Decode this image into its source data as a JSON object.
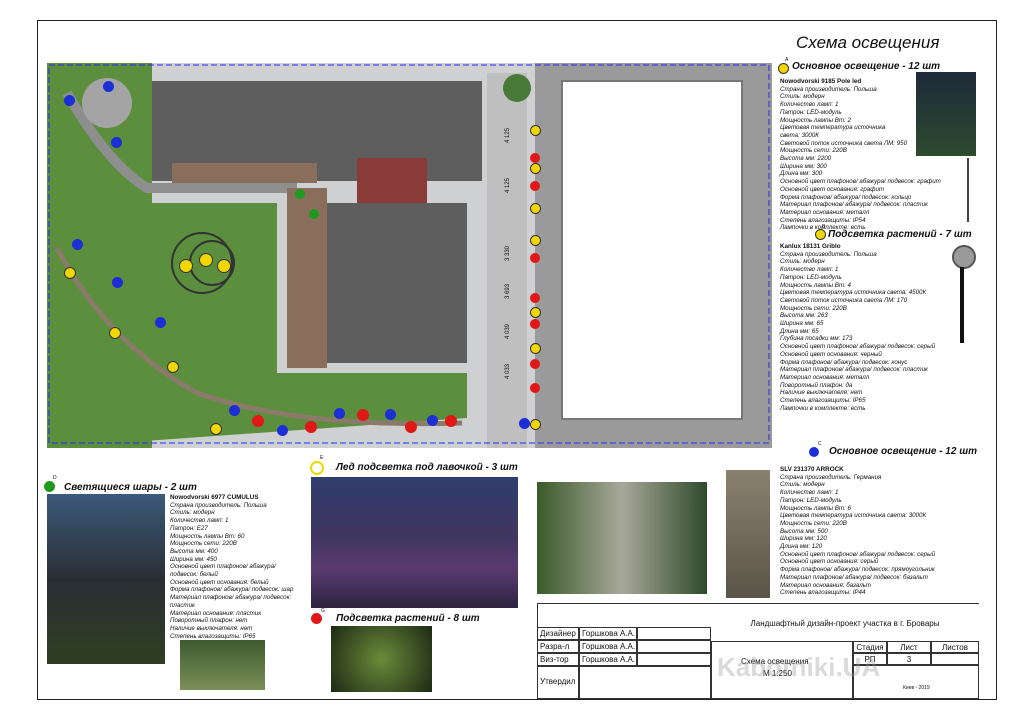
{
  "title": "Схема освещения",
  "sections": {
    "main_top": "Основное освещение - 12 шт",
    "plants_top": "Подсветка растений - 7 шт",
    "main_bottom": "Основное освещение - 12 шт",
    "spheres": "Светящиеся шары - 2 шт",
    "bench": "Лед подсветка под лавочкой - 3 шт",
    "plants_bottom": "Подсветка растений - 8 шт"
  },
  "markers": {
    "a": "A",
    "b": "B",
    "c": "C",
    "d": "D",
    "e": "E",
    "f": "F",
    "g": "G"
  },
  "colors": {
    "yellow": "#f2d600",
    "blue": "#1c2fd6",
    "green": "#1f9a1f",
    "red": "#e01818",
    "lawn": "#5b8f3e",
    "roof": "#5e5e5e"
  },
  "spec_pole": [
    "Nowodvorski 9185 Pole led",
    "Страна производитель: Польша",
    "Стиль: модерн",
    "Количество ламп: 1",
    "Патрон: LED-модуль",
    "Мощность лампы Вт: 2",
    "Цветовая температура источника",
    "света: 3000К",
    "Световой поток источника света ЛМ: 950",
    "Мощность сети: 220В",
    "Высота мм: 2200",
    "Ширина мм: 300",
    "Длина мм: 300",
    "Основной цвет плафонов/ абажура/ подвесок: графит",
    "Основной цвет основания: графит",
    "Форма плафонов/ абажура/ подвесок: кольцо",
    "Материал плафонов/ абажура/ подвесок: пластик",
    "Материал основания: металл",
    "Степень влагозащиты: IP54",
    "Лампочки в комплекте: есть"
  ],
  "spec_griblo": [
    "Kanlux 18131 Griblo",
    "Страна производитель: Польша",
    "Стиль: модерн",
    "Количество ламп: 1",
    "Патрон: LED-модуль",
    "Мощность лампы Вт: 4",
    "Цветовая температура источника света: 4500К",
    "Световой поток источника света ЛМ: 170",
    "Мощность сети: 220В",
    "Высота мм: 263",
    "Ширина мм: 65",
    "Длина мм: 65",
    "Глубина посадки мм: 173",
    "Основной цвет плафонов/ абажура/ подвесок: серый",
    "Основной цвет основания: черный",
    "Форма плафонов/ абажура/ подвесок: конус",
    "Материал плафонов/ абажура/ подвесок: пластик",
    "Материал основания: металл",
    "Поворотный плафон: да",
    "Наличие выключателя: нет",
    "Степень влагозащиты: IP65",
    "Лампочки в комплекте: есть"
  ],
  "spec_cumulus": [
    "Nowodvorski 6977 CUMULUS",
    "Страна производитель: Польша",
    "Стиль: модерн",
    "Количество ламп: 1",
    "Патрон: E27",
    "Мощность лампы Вт: 60",
    "Мощность сети: 220В",
    "Высота мм: 400",
    "Ширина мм: 450",
    "Основной цвет плафонов/ абажура/",
    "подвесок: белый",
    "Основной цвет основания: белый",
    "Форма плафонов/ абажура/ подвесок: шар",
    "Материал плафонов/ абажура/ подвесок:",
    "пластик",
    "Материал основания: пластик",
    "Поворотный плафон: нет",
    "Наличие выключателя: нет",
    "Степень влагозащиты: IP65"
  ],
  "spec_arrock": [
    "SLV 231370 ARROCK",
    "Страна производитель: Германия",
    "Стиль: модерн",
    "Количество ламп: 1",
    "Патрон: LED-модуль",
    "Мощность лампы Вт: 6",
    "Цветовая температура источника света: 3000К",
    "Мощность сети: 220В",
    "Высота мм: 500",
    "Ширина мм: 120",
    "Длина мм: 120",
    "Основной цвет плафонов/ абажура/ подвесок: серый",
    "Основной цвет основания: серый",
    "Форма плафонов/ абажура/ подвесок: прямоугольник",
    "Материал плафонов/ абажура/ подвесок: базальт",
    "Материал основания: базальт",
    "Степень влагозащиты: IP44"
  ],
  "dimensions": [
    "4 125",
    "4 125",
    "3 330",
    "3 693",
    "4 039",
    "4 033"
  ],
  "title_block": {
    "project": "Ландшафтный дизайн-проект участка в г. Бровары",
    "roles": [
      "Дизайнер",
      "Разра-л",
      "Виз-тор",
      "Утвердил"
    ],
    "names": [
      "Горшкова А.А.",
      "Горшкова А.А.",
      "Горшкова А.А.",
      ""
    ],
    "sheet_name": "Схема освещения",
    "scale": "М 1:250",
    "h_stage": "Стадия",
    "h_sheet": "Лист",
    "h_sheets": "Листов",
    "stage": "РП",
    "sheet": "3",
    "sheets": "",
    "city_year": "Киев - 2019"
  },
  "watermark": "Kabotniki.UA"
}
